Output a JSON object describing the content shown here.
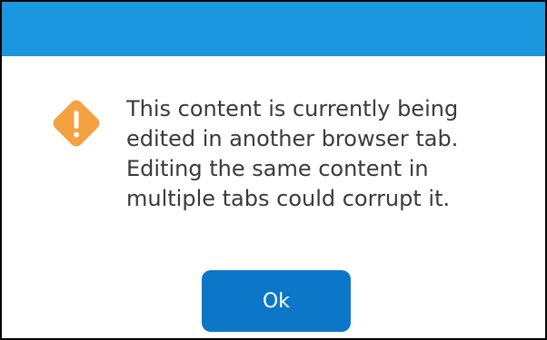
{
  "dialog": {
    "message_lines": [
      "This content is currently being",
      "edited in another browser tab.",
      "Editing the same content in",
      "multiple tabs could corrupt it."
    ],
    "icon": "warning-icon",
    "ok_label": "Ok"
  },
  "colors": {
    "title_bar": "#1b97e0",
    "warning_icon": "#f4a142",
    "button": "#0c77c9",
    "text": "#3a3a3a"
  }
}
